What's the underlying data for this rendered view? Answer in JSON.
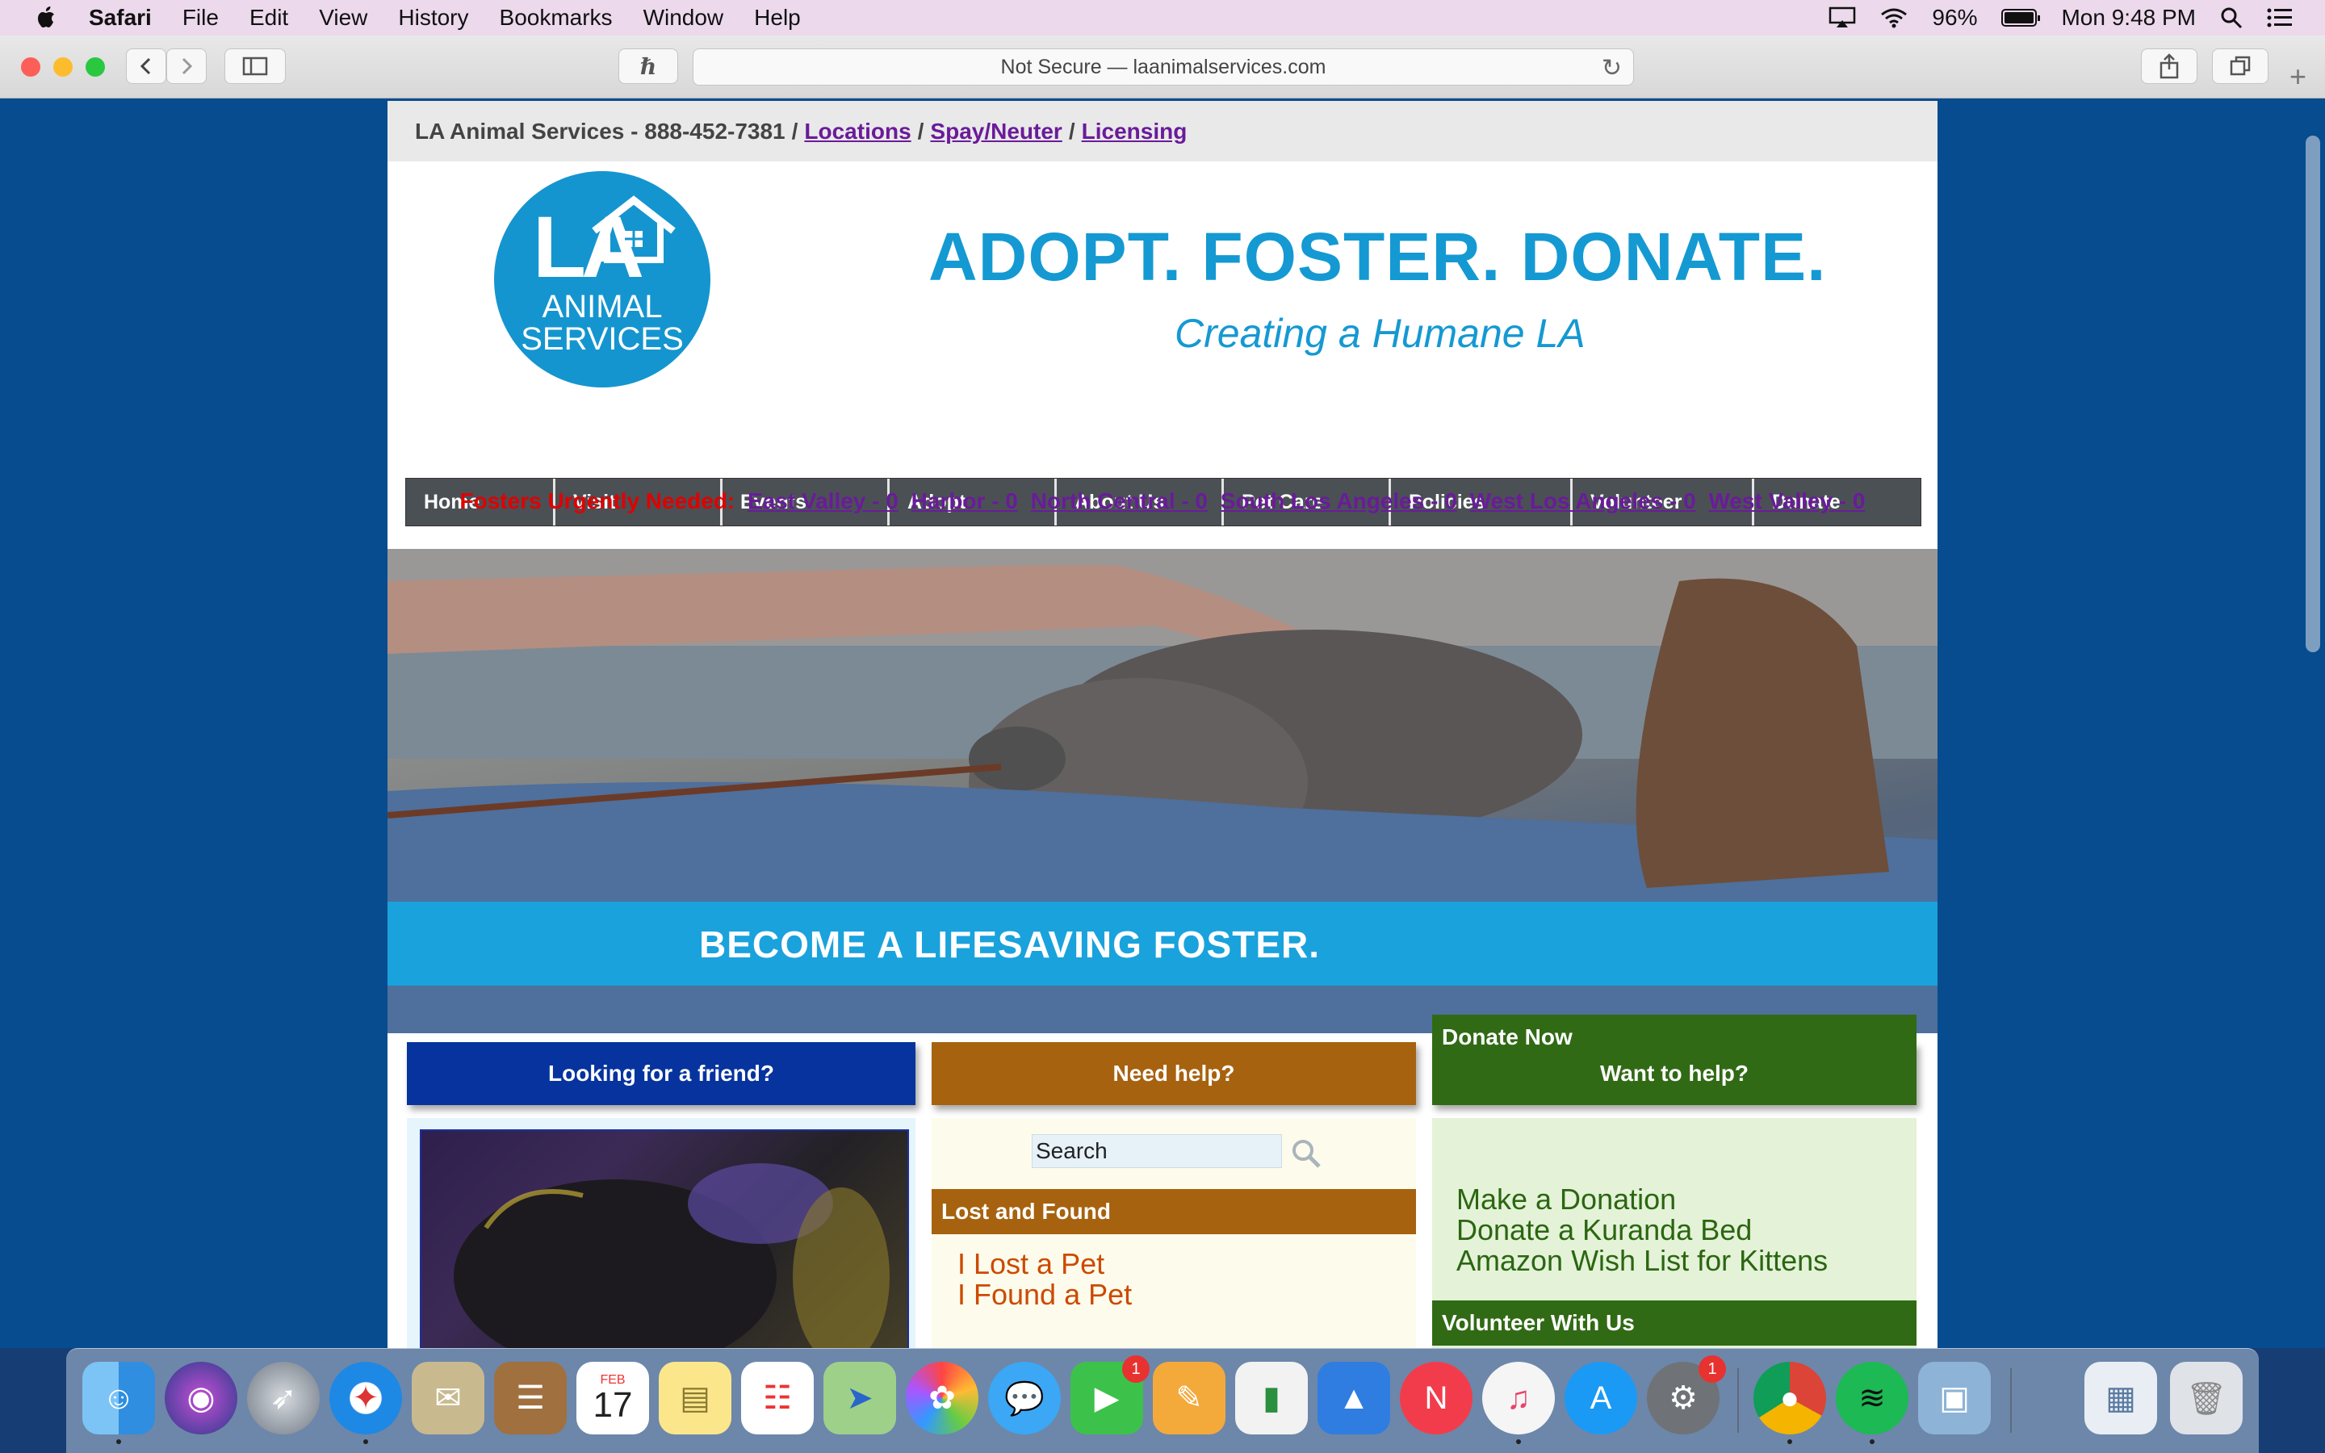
{
  "menubar": {
    "app": "Safari",
    "items": [
      "File",
      "Edit",
      "View",
      "History",
      "Bookmarks",
      "Window",
      "Help"
    ],
    "battery_percent": "96%",
    "clock": "Mon 9:48 PM"
  },
  "browser": {
    "address": "Not Secure — laanimalservices.com"
  },
  "site": {
    "topbar": {
      "prefix": "LA Animal Services - 888-452-7381",
      "links": [
        "Locations",
        "Spay/Neuter",
        "Licensing"
      ],
      "separator": "/"
    },
    "logo": {
      "la": "LA",
      "line1": "ANIMAL",
      "line2": "SERVICES"
    },
    "slogan": "ADOPT. FOSTER. DONATE.",
    "tagline": "Creating a Humane LA",
    "nav": [
      "Home",
      "Visit",
      "Events",
      "Adopt",
      "About Us",
      "Pet Care",
      "Policies",
      "Volunteer",
      "Donate"
    ],
    "fosters": {
      "label": "Fosters Urgently Needed:",
      "links": [
        "East Valley - 0",
        "Harbor - 0",
        "North Central - 0",
        "South Los Angeles - 0",
        "West Los Angeles - 0",
        "West Valley - 0"
      ]
    },
    "hero_banner": "BECOME A LIFESAVING FOSTER.",
    "columns": {
      "friend": {
        "heading": "Looking for a friend?"
      },
      "help": {
        "heading": "Need help?",
        "search_value": "Search",
        "lost_found_heading": "Lost and Found",
        "links": [
          "I Lost a Pet",
          "I Found a Pet"
        ]
      },
      "want": {
        "heading": "Want to help?",
        "donate_heading": "Donate Now",
        "donate_links": [
          "Make a Donation",
          "Donate a Kuranda Bed",
          "Amazon Wish List for Kittens"
        ],
        "volunteer_heading": "Volunteer With Us"
      }
    }
  },
  "dock": {
    "calendar_month": "FEB",
    "calendar_day": "17",
    "facetime_badge": "1",
    "sysprefs_badge": "1"
  },
  "colors": {
    "page_bg": "#064c8e",
    "brand_blue": "#1599d2",
    "nav_bg": "#4b5055",
    "friend_blue": "#06339e",
    "help_brown": "#a7620f",
    "want_green": "#316a15",
    "link_purple": "#6a1b9a",
    "urgent_red": "#e00000"
  }
}
